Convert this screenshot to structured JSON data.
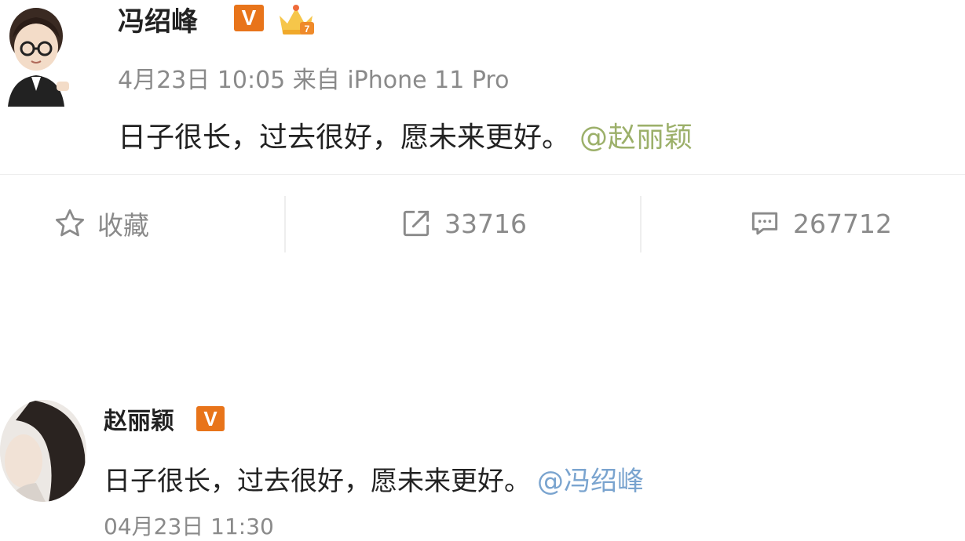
{
  "post1": {
    "author": "冯绍峰",
    "verified": "V",
    "meta": "4月23日 10:05 来自 iPhone 11 Pro",
    "text": "日子很长，过去很好，愿未来更好。",
    "mention": "@赵丽颖",
    "actions": {
      "favorite_label": "收藏",
      "repost_count": "33716",
      "comment_count": "267712"
    },
    "icons": [
      "star-icon",
      "repost-icon",
      "comment-icon"
    ]
  },
  "post2": {
    "author": "赵丽颖",
    "verified": "V",
    "text": "日子很长，过去很好，愿未来更好。",
    "mention": "@冯绍峰",
    "meta_partial": "04月23日 11:30"
  },
  "colors": {
    "verified_badge": "#e8741a",
    "mention1": "#9cb06a",
    "mention2": "#7aa4cf",
    "meta_text": "#8a8a8a"
  }
}
